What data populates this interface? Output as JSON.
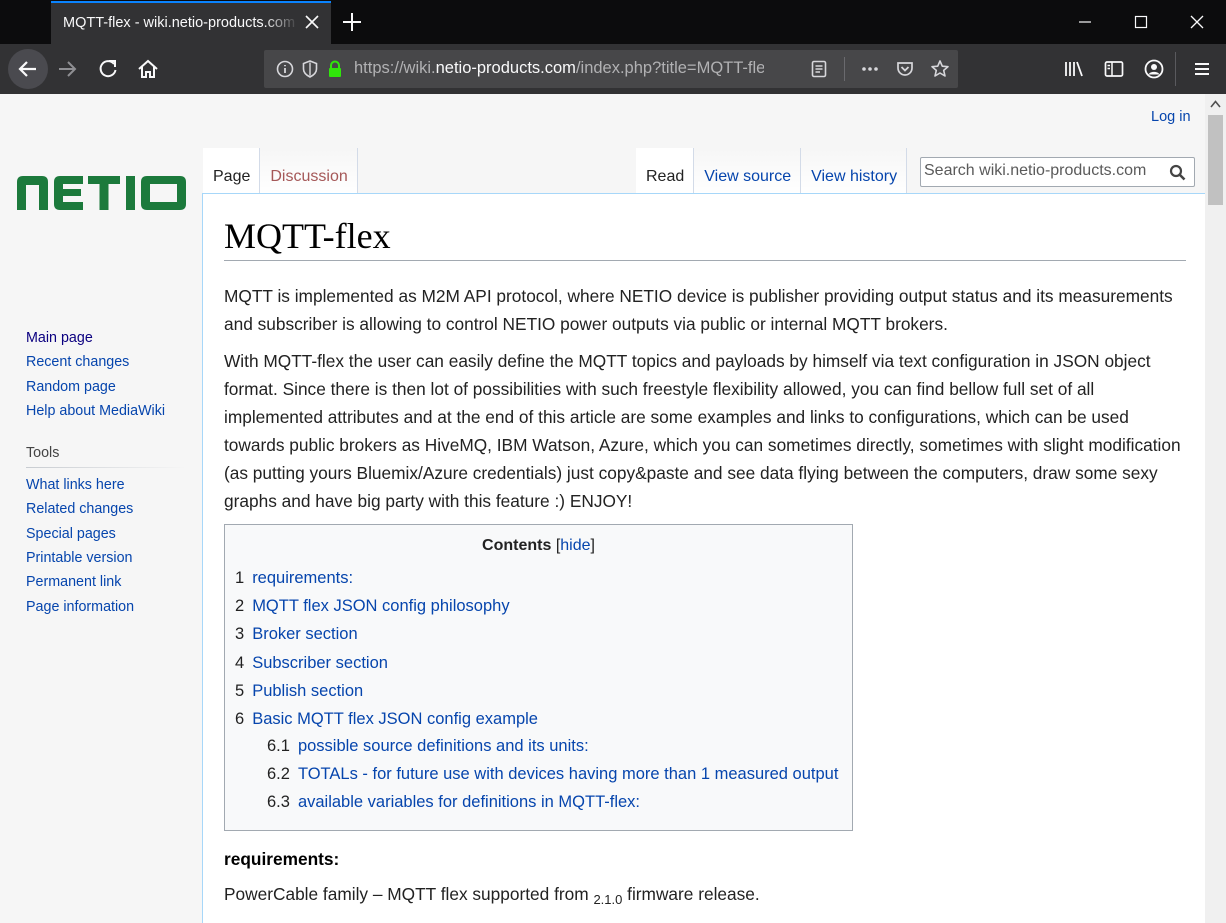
{
  "browser": {
    "tab_title": "MQTT-flex - wiki.netio-products.com",
    "url_scheme": "https://wiki.",
    "url_host": "netio-products.com",
    "url_path": "/index.php?title=MQTT-flex"
  },
  "wiki": {
    "login": "Log in",
    "logo_text": "NETIO",
    "tabs_left": [
      "Page",
      "Discussion"
    ],
    "tabs_right": [
      "Read",
      "View source",
      "View history"
    ],
    "search_placeholder": "Search wiki.netio-products.com",
    "nav": [
      "Main page",
      "Recent changes",
      "Random page",
      "Help about MediaWiki"
    ],
    "tools_heading": "Tools",
    "tools": [
      "What links here",
      "Related changes",
      "Special pages",
      "Printable version",
      "Permanent link",
      "Page information"
    ]
  },
  "article": {
    "title": "MQTT-flex",
    "para1": "MQTT is implemented as M2M API protocol, where NETIO device is publisher providing output status and its measurements and subscriber is allowing to control NETIO power outputs via public or internal MQTT brokers.",
    "para2": "With MQTT-flex the user can easily define the MQTT topics and payloads by himself via text configuration in JSON object format. Since there is then lot of possibilities with such freestyle flexibility allowed, you can find bellow full set of all implemented attributes and at the end of this article are some examples and links to configurations, which can be used towards public brokers as HiveMQ, IBM Watson, Azure, which you can sometimes directly, sometimes with slight modification (as putting yours Bluemix/Azure credentials) just copy&paste and see data flying between the computers, draw some sexy graphs and have big party with this feature :) ENJOY!",
    "toc": {
      "title": "Contents",
      "hide_open": "[",
      "hide": "hide",
      "hide_close": "]",
      "items": [
        {
          "num": "1",
          "text": "requirements:"
        },
        {
          "num": "2",
          "text": "MQTT flex JSON config philosophy"
        },
        {
          "num": "3",
          "text": "Broker section"
        },
        {
          "num": "4",
          "text": "Subscriber section"
        },
        {
          "num": "5",
          "text": "Publish section"
        },
        {
          "num": "6",
          "text": "Basic MQTT flex JSON config example"
        },
        {
          "num": "6.1",
          "text": "possible source definitions and its units:"
        },
        {
          "num": "6.2",
          "text": "TOTALs - for future use with devices having more than 1 measured output"
        },
        {
          "num": "6.3",
          "text": "available variables for definitions in MQTT-flex:"
        }
      ]
    },
    "section1_heading": "requirements:",
    "section1_text_before": "PowerCable family – MQTT flex supported from ",
    "section1_version": "2.1.0",
    "section1_text_after": " firmware release."
  }
}
